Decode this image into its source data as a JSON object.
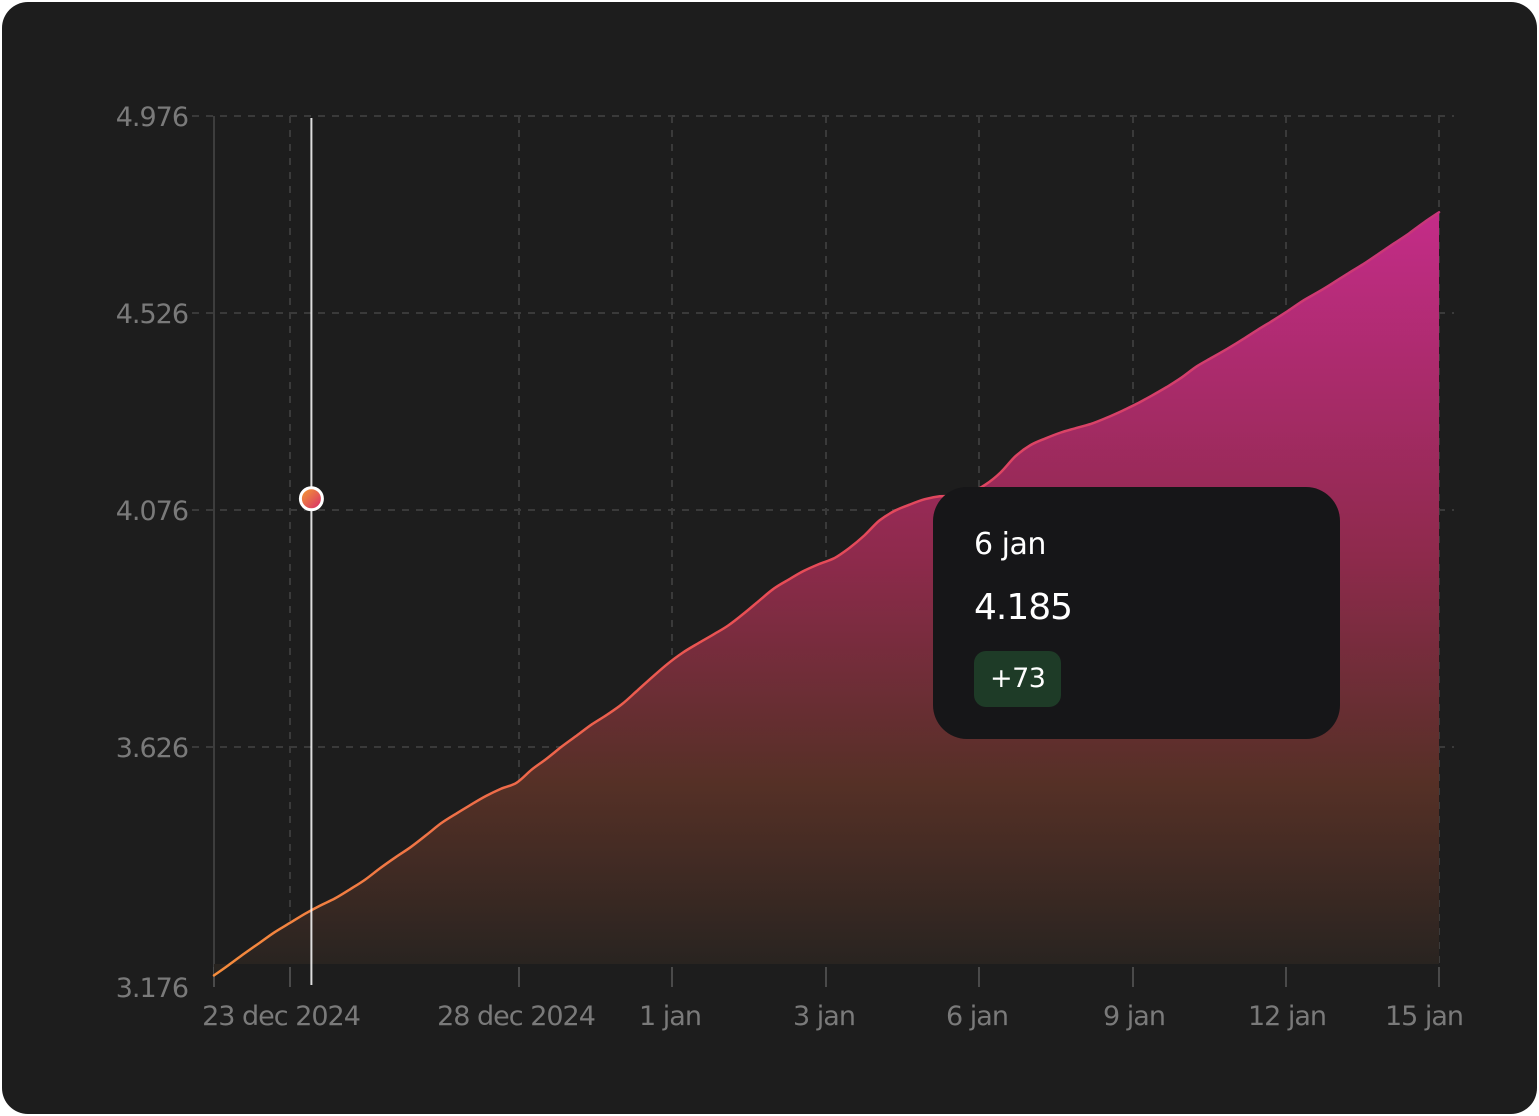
{
  "chart_data": {
    "type": "area",
    "y_ticks": [
      "4.976",
      "4.526",
      "4.076",
      "3.626",
      "3.176"
    ],
    "x_ticks": [
      "23 dec 2024",
      "28 dec 2024",
      "1 jan",
      "3 jan",
      "6 jan",
      "9 jan",
      "12 jan",
      "15 jan"
    ],
    "ylim": [
      3176,
      4976
    ],
    "grid": true,
    "series": [
      {
        "x": [
          -1,
          0,
          1,
          2,
          3,
          4,
          5,
          6,
          7,
          8,
          9,
          10,
          11,
          12,
          13,
          14,
          15,
          16,
          17,
          18,
          19,
          20,
          21,
          22,
          23,
          24,
          25,
          26,
          27,
          28,
          29,
          30,
          31,
          32,
          33,
          34,
          35,
          36,
          37,
          38,
          39,
          40,
          41,
          42,
          43,
          44,
          45,
          46,
          47,
          48,
          49,
          50,
          51,
          52,
          53,
          54,
          55,
          56,
          57,
          58,
          59,
          60,
          61,
          62,
          63,
          64,
          65,
          66,
          67,
          68,
          69,
          70,
          71,
          72,
          73,
          74,
          75,
          76,
          77,
          78,
          79,
          80
        ],
        "y": [
          3200,
          3222,
          3245,
          3267,
          3289,
          3308,
          3327,
          3344,
          3359,
          3378,
          3398,
          3422,
          3444,
          3465,
          3489,
          3514,
          3534,
          3553,
          3571,
          3586,
          3598,
          3625,
          3648,
          3673,
          3696,
          3719,
          3739,
          3761,
          3789,
          3817,
          3844,
          3867,
          3886,
          3904,
          3923,
          3947,
          3973,
          3999,
          4018,
          4036,
          4050,
          4062,
          4083,
          4109,
          4140,
          4160,
          4173,
          4184,
          4190,
          4191,
          4198,
          4214,
          4239,
          4273,
          4296,
          4310,
          4322,
          4331,
          4340,
          4352,
          4366,
          4381,
          4398,
          4416,
          4436,
          4459,
          4477,
          4495,
          4514,
          4534,
          4553,
          4573,
          4594,
          4612,
          4631,
          4651,
          4670,
          4691,
          4712,
          4733,
          4756,
          4777
        ]
      }
    ],
    "hover": {
      "label": "6 jan",
      "value": "4.185",
      "change": "+73",
      "x": 5.44,
      "y": 4185
    },
    "colors": {
      "background": "#1d1d1d",
      "grid": "#3a3a3a",
      "line_start": "#f58c3c",
      "line_end": "#c8367a",
      "fill_top": "#c42c88",
      "fill_bottom": "#2a2722",
      "badge": "#1e3b27"
    }
  },
  "tooltip": {
    "date": "6 jan",
    "value": "4.185",
    "change": "+73"
  }
}
